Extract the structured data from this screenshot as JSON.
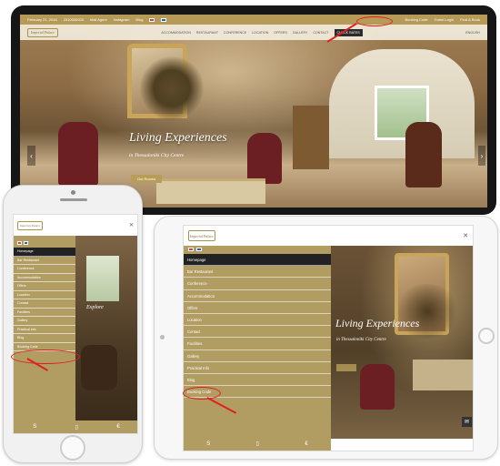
{
  "desktop": {
    "topbar": {
      "date": "February 21, 2016",
      "phone": "2310000000",
      "links": [
        "Mail Agent",
        "Instagram",
        "Blog"
      ],
      "booking": "Booking Code",
      "guest": "Guest Login",
      "find": "Find & Book"
    },
    "nav": {
      "logo": "Imperial Palace",
      "items": [
        "ACCOMMODATION",
        "RESTAURANT",
        "CONFERENCE",
        "LOCATION",
        "OFFERS",
        "GALLERY",
        "CONTACT",
        "CHECK RATES"
      ],
      "lang": "ENGLISH"
    },
    "hero": {
      "title": "Living Experiences",
      "subtitle": "in Thessaloniki City Centre",
      "button": "Our Rooms"
    }
  },
  "phone": {
    "logo": "Imperial Palace",
    "menu": [
      "Homepage",
      "Bar Restaurant",
      "Conference",
      "Accommodation",
      "Offers",
      "Location",
      "Contact",
      "Facilities",
      "Gallery",
      "Practical info",
      "Blog",
      "Booking Code"
    ],
    "hero_text": "Explore"
  },
  "tablet": {
    "logo": "Imperial Palace",
    "menu": [
      "Homepage",
      "Bar Restaurant",
      "Conference",
      "Accommodation",
      "Offers",
      "Location",
      "Contact",
      "Facilities",
      "Gallery",
      "Practical Info",
      "Blog",
      "Booking Code"
    ],
    "hero": {
      "title": "Living Experiences",
      "subtitle": "in Thessaloniki City Centre"
    }
  },
  "colors": {
    "gold": "#b19c62",
    "highlight": "#e01f1f",
    "active_menu": "#222222"
  },
  "icons": [
    "skype-icon",
    "mobile-icon",
    "euro-icon",
    "mail-icon",
    "close-icon"
  ]
}
